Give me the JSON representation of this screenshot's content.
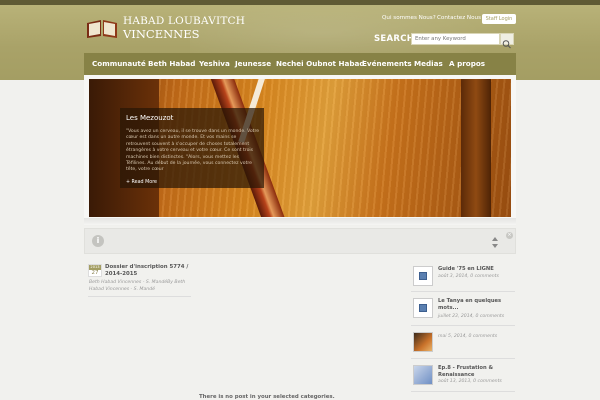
{
  "brand": {
    "line1": "HABAD LOUBAVITCH",
    "line2": "VINCENNES"
  },
  "toplinks": {
    "about": "Qui sommes Nous?",
    "contact": "Contactez Nous",
    "staff": "Staff Login"
  },
  "search": {
    "label": "SEARCH",
    "placeholder": "Enter any Keyword"
  },
  "nav": {
    "items": [
      "Communauté",
      "Beth Habad",
      "Yeshiva",
      "Jeunesse",
      "Nechei Oubnot Habad",
      "Evénements",
      "Medias",
      "A propos"
    ]
  },
  "slider": {
    "title": "Les Mezouzot",
    "text": "\"Vous avez un cerveau, il se trouve dans un monde. Votre cœur est dans un autre monde. Et vos mains se retrouvent souvent à s'occuper de choses totalement étrangères à votre cerveau et votre cœur. Ce sont trois machines bien distinctes. \"Alors, vous mettez les Téfilines. Au début de la journée, vous connectez votre tête, votre cœur",
    "more": "+ Read More"
  },
  "post": {
    "month": "2013",
    "day": "27",
    "title": "Dossier d'inscription 5774 / 2014-2015",
    "meta": "Beth Habad Vincennes - S. MandéBy Beth Habad Vincennes - S. Mandé"
  },
  "empty_message": "There is no post in your selected categories.",
  "sidebar": {
    "items": [
      {
        "title": "Guide '75 en LIGNE",
        "meta": "août 3, 2014, 0 comments"
      },
      {
        "title": "Le Tanya en quelques mots...",
        "meta": "juillet 23, 2014, 0 comments"
      },
      {
        "title": "",
        "meta": "mai 5, 2014, 0 comments"
      },
      {
        "title": "Ep.8 - Frustation & Renaissance",
        "meta": "août 13, 2013, 0 comments"
      }
    ]
  },
  "colors": {
    "header": "#a9a268",
    "nav": "#878246",
    "accent": "#a49e63"
  }
}
